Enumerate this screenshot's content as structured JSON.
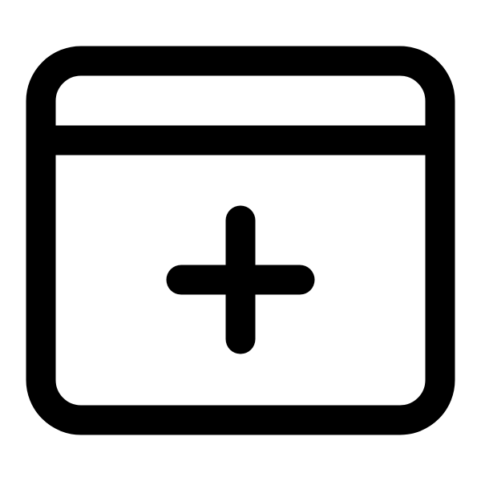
{
  "icon": {
    "name": "new-window-icon",
    "stroke_color": "#000000",
    "background_color": "#ffffff",
    "parts": [
      "window-frame",
      "title-bar-divider",
      "plus-sign"
    ]
  }
}
